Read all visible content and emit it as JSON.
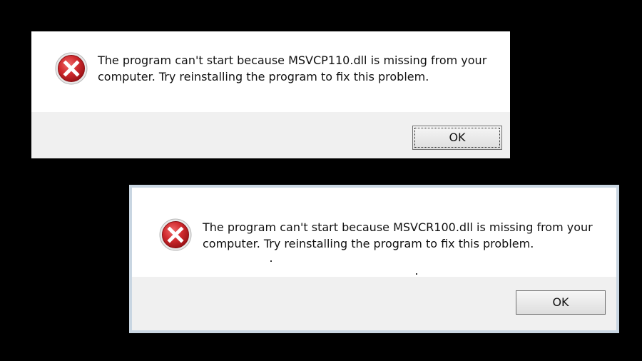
{
  "dialogs": [
    {
      "message_line1": "The program can't start because MSVCP110.dll is missing from your",
      "message_line2": "computer. Try reinstalling the program to fix this problem.",
      "ok_label": "OK",
      "icon": "error-icon"
    },
    {
      "message_line1": "The program can't start because MSVCR100.dll is missing from your",
      "message_line2": "computer. Try reinstalling the program to fix this problem.",
      "ok_label": "OK",
      "icon": "error-icon"
    }
  ],
  "colors": {
    "background": "#000000",
    "dialog_body": "#ffffff",
    "button_bar": "#f0f0f0",
    "error_red": "#c8262b"
  }
}
